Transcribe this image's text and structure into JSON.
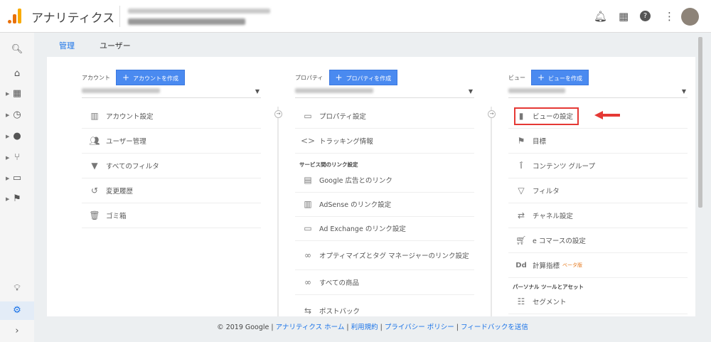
{
  "header": {
    "title": "アナリティクス"
  },
  "tabs": [
    {
      "label": "管理"
    },
    {
      "label": "ユーザー"
    }
  ],
  "account": {
    "label": "アカウント",
    "create": "アカウントを作成",
    "items": [
      "アカウント設定",
      "ユーザー管理",
      "すべてのフィルタ",
      "変更履歴",
      "ゴミ箱"
    ]
  },
  "property": {
    "label": "プロパティ",
    "create": "プロパティを作成",
    "items": [
      "プロパティ設定",
      "トラッキング情報"
    ],
    "section": "サービス間のリンク設定",
    "links": [
      "Google 広告とのリンク",
      "AdSense のリンク設定",
      "Ad Exchange のリンク設定",
      "オプティマイズとタグ マネージャーのリンク設定",
      "すべての商品",
      "ポストバック"
    ]
  },
  "view": {
    "label": "ビュー",
    "create": "ビューを作成",
    "items": [
      "ビューの設定",
      "目標",
      "コンテンツ グループ",
      "フィルタ",
      "チャネル設定",
      "e コマースの設定",
      "計算指標"
    ],
    "beta": "ベータ版",
    "section": "パーソナル ツールとアセット",
    "personal": [
      "セグメント"
    ]
  },
  "footer": {
    "copyright": "© 2019 Google",
    "links": [
      "アナリティクス ホーム",
      "利用規約",
      "プライバシー ポリシー",
      "フィードバックを送信"
    ],
    "sep": "|"
  },
  "colors": {
    "accent": "#1a73e8",
    "button": "#4a8af0",
    "highlight": "#e53935",
    "tab_underline": "#f57c00"
  }
}
